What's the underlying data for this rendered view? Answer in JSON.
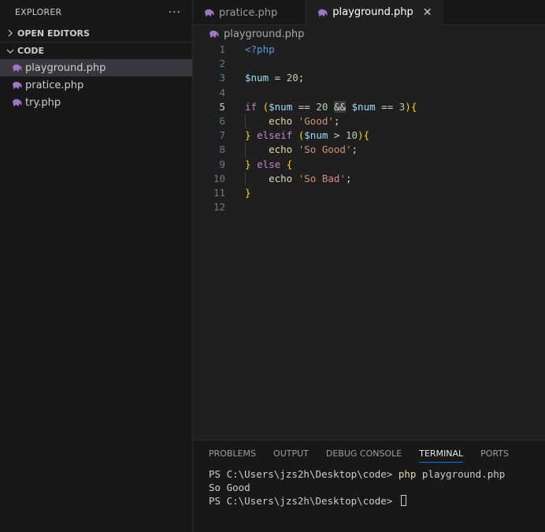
{
  "explorer": {
    "title": "EXPLORER",
    "more": "···",
    "open_editors": "OPEN EDITORS",
    "folder": "CODE",
    "files": [
      "playground.php",
      "pratice.php",
      "try.php"
    ]
  },
  "tabs": [
    {
      "label": "pratice.php"
    },
    {
      "label": "playground.php",
      "close": "✕"
    }
  ],
  "breadcrumb": "playground.php",
  "editor": {
    "line_numbers": [
      "1",
      "2",
      "3",
      "4",
      "5",
      "6",
      "7",
      "8",
      "9",
      "10",
      "11",
      "12"
    ],
    "l1": "<?php",
    "l3_var": "$num",
    "l3_rest": " = ",
    "l3_num": "20",
    "l3_end": ";",
    "l5_if": "if",
    "l5_var1": "$num",
    "l5_op1": " == ",
    "l5_n1": "20",
    "l5_amp": "&&",
    "l5_var2": "$num",
    "l5_op2": " == ",
    "l5_n2": "3",
    "echo": "echo",
    "l6_str": "'Good'",
    "l7_kw": "elseif",
    "l7_var": "$num",
    "l7_op": " > ",
    "l7_n": "10",
    "l8_str": "'So Good'",
    "l9_kw": "else",
    "l10_str": "'So Bad'"
  },
  "panel": {
    "tabs": [
      "PROBLEMS",
      "OUTPUT",
      "DEBUG CONSOLE",
      "TERMINAL",
      "PORTS"
    ],
    "active_tab": "TERMINAL",
    "terminal": {
      "prompt1": "PS C:\\Users\\jzs2h\\Desktop\\code> ",
      "cmd_php": "php",
      "cmd_file": " playground.php",
      "output": "So Good",
      "prompt2": "PS C:\\Users\\jzs2h\\Desktop\\code> "
    }
  }
}
